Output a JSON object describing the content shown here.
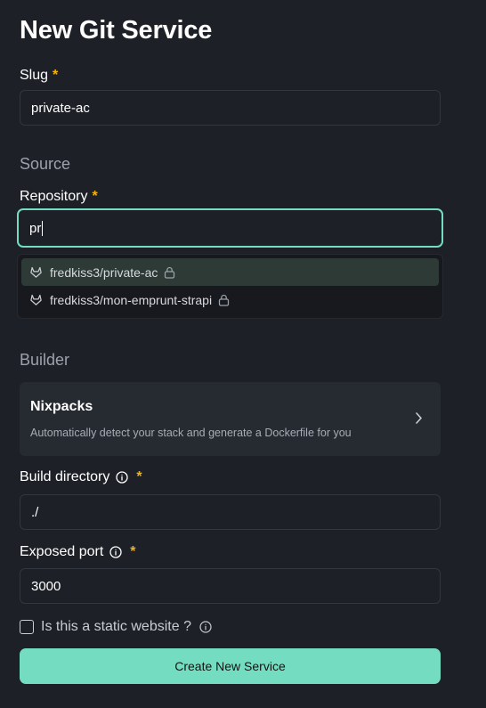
{
  "page": {
    "title": "New Git Service"
  },
  "colors": {
    "accent": "#74ddc1",
    "required": "#f5b40b",
    "background": "#1d2027"
  },
  "slug": {
    "label": "Slug",
    "required_mark": "*",
    "value": "private-ac"
  },
  "source": {
    "section_title": "Source",
    "repository": {
      "label": "Repository",
      "required_mark": "*",
      "value": "pr",
      "suggestions": [
        {
          "label": "fredkiss3/private-ac",
          "icon": "gitlab-icon",
          "private": true,
          "highlighted": true
        },
        {
          "label": "fredkiss3/mon-emprunt-strapi",
          "icon": "gitlab-icon",
          "private": true,
          "highlighted": false
        }
      ]
    }
  },
  "builder": {
    "section_title": "Builder",
    "option": {
      "name": "Nixpacks",
      "description": "Automatically detect your stack and generate a Dockerfile for you",
      "icon": "chevron-right-icon"
    }
  },
  "build_directory": {
    "label": "Build directory",
    "required_mark": "*",
    "value": "./",
    "icon": "info-icon"
  },
  "exposed_port": {
    "label": "Exposed port",
    "required_mark": "*",
    "value": "3000",
    "icon": "info-icon"
  },
  "static_website": {
    "label": "Is this a static website ?",
    "checked": false,
    "icon": "info-icon"
  },
  "submit": {
    "label": "Create New Service"
  }
}
